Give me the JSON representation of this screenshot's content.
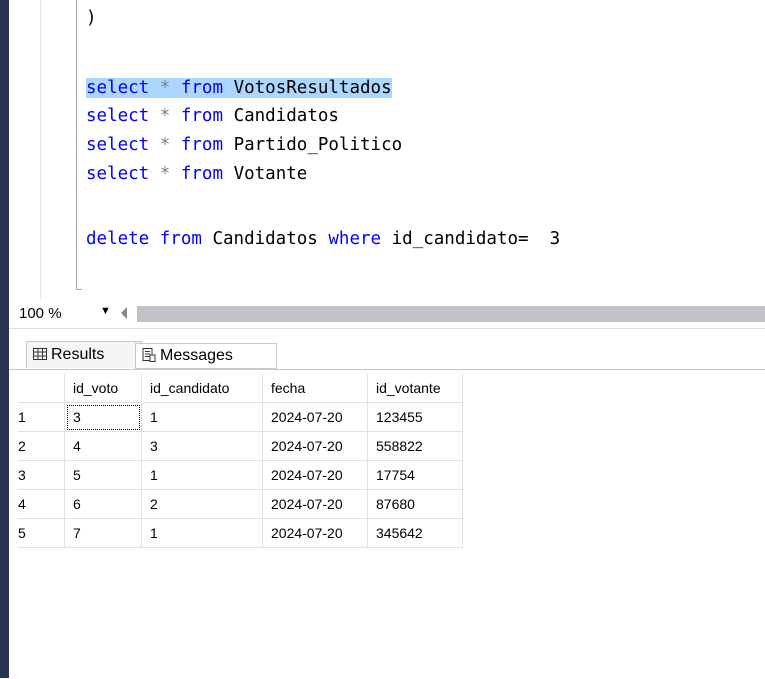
{
  "editor": {
    "lines": [
      {
        "kw1": "select",
        "op": "*",
        "kw2": "from",
        "obj": "VotosResultados"
      },
      {
        "kw1": "select",
        "op": "*",
        "kw2": "from",
        "obj": "Candidatos"
      },
      {
        "kw1": "select",
        "op": "*",
        "kw2": "from",
        "obj": "Partido_Politico"
      },
      {
        "kw1": "select",
        "op": "*",
        "kw2": "from",
        "obj": "Votante"
      }
    ],
    "paren": ")",
    "delete_line": {
      "kw1": "delete",
      "kw2": "from",
      "obj": "Candidatos",
      "kw3": "where",
      "col": "id_candidato=",
      "val": "3"
    }
  },
  "zoom": {
    "value": "100 %",
    "dropdown_icon": "chevron-down-icon"
  },
  "tabs": {
    "results": "Results",
    "messages": "Messages"
  },
  "grid": {
    "headers": [
      "id_voto",
      "id_candidato",
      "fecha",
      "id_votante"
    ],
    "rows": [
      {
        "n": "1",
        "id_voto": "3",
        "id_candidato": "1",
        "fecha": "2024-07-20",
        "id_votante": "123455"
      },
      {
        "n": "2",
        "id_voto": "4",
        "id_candidato": "3",
        "fecha": "2024-07-20",
        "id_votante": "558822"
      },
      {
        "n": "3",
        "id_voto": "5",
        "id_candidato": "1",
        "fecha": "2024-07-20",
        "id_votante": "17754"
      },
      {
        "n": "4",
        "id_voto": "6",
        "id_candidato": "2",
        "fecha": "2024-07-20",
        "id_votante": "87680"
      },
      {
        "n": "5",
        "id_voto": "7",
        "id_candidato": "1",
        "fecha": "2024-07-20",
        "id_votante": "345642"
      }
    ]
  },
  "colors": {
    "keyword": "#0000ff",
    "selection": "#add6ff",
    "left_bar": "#27344f"
  }
}
